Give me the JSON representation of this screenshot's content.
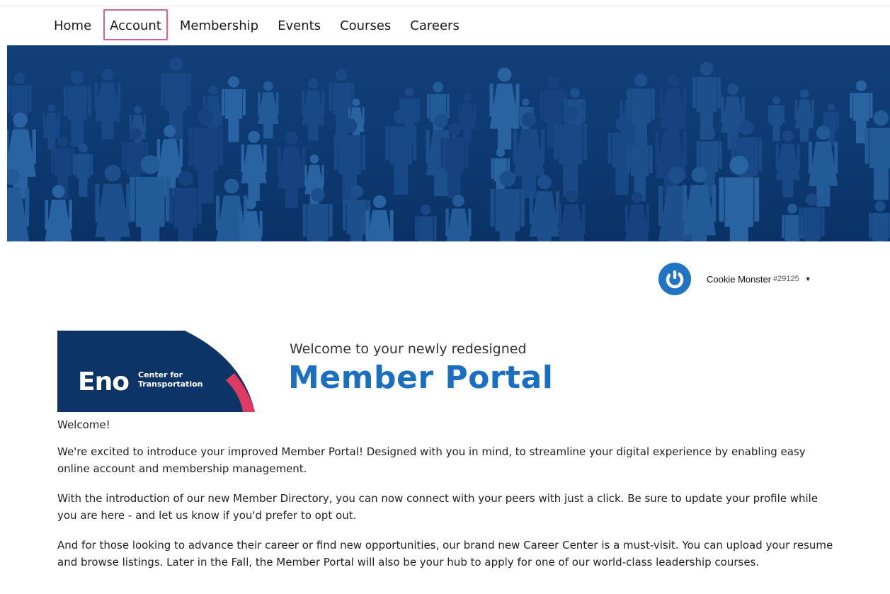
{
  "nav": {
    "items": [
      {
        "label": "Home",
        "active": false
      },
      {
        "label": "Account",
        "active": true
      },
      {
        "label": "Membership",
        "active": false
      },
      {
        "label": "Events",
        "active": false
      },
      {
        "label": "Courses",
        "active": false
      },
      {
        "label": "Careers",
        "active": false
      }
    ]
  },
  "banner": {
    "description_icon": "people-pattern"
  },
  "user": {
    "name": "Cookie Monster",
    "id": "#29125",
    "avatar_icon": "power-icon",
    "avatar_color": "#1f74c4"
  },
  "logo": {
    "brand": "Eno",
    "line1": "Center for",
    "line2": "Transportation",
    "bg_color": "#0d3466",
    "accent_color": "#e03a62"
  },
  "hero": {
    "subtitle": "Welcome to your newly redesigned",
    "title": "Member Portal",
    "title_color": "#1b6fc2"
  },
  "content": {
    "greeting": "Welcome!",
    "paragraphs": [
      "We're excited to introduce your improved Member Portal! Designed with you in mind, to streamline your digital experience by enabling easy online account and membership management.",
      "With the introduction of our new Member Directory, you can now connect with your peers with just a click. Be sure to update your profile while you are here - and let us know if you'd prefer to opt out.",
      "And for those looking to advance their career or find new opportunities, our brand new Career Center is a must-visit. You can upload your resume and browse listings. Later in the Fall, the Member Portal will also be your hub to apply for one of our world-class leadership courses."
    ]
  }
}
